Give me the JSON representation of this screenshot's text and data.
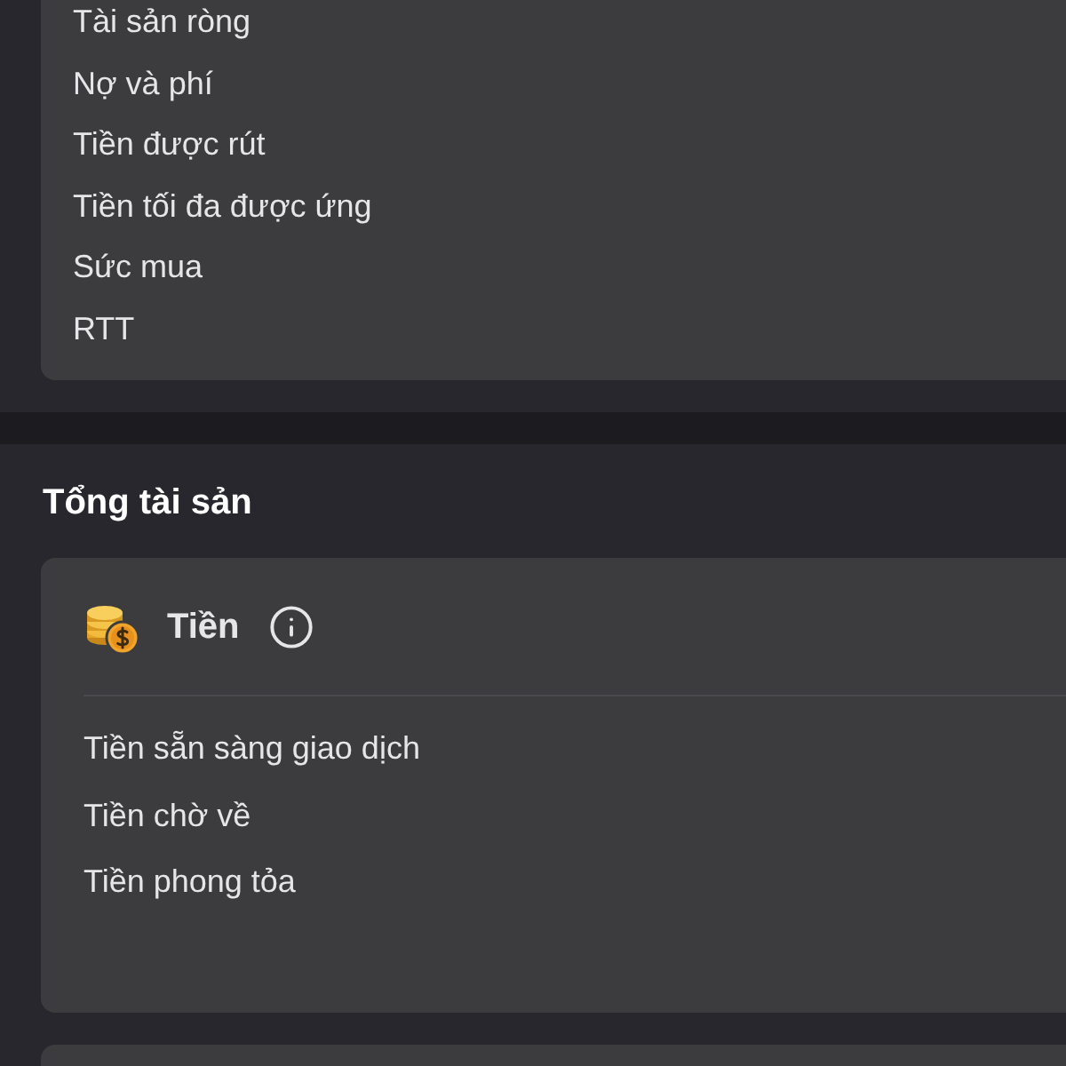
{
  "summary_card": {
    "items": [
      "Tài sản ròng",
      "Nợ và phí",
      "Tiền được rút",
      "Tiền tối đa được ứng",
      "Sức mua",
      "RTT"
    ]
  },
  "total_assets": {
    "title": "Tổng tài sản",
    "cash_card": {
      "title": "Tiền",
      "items": [
        "Tiền sẵn sàng giao dịch",
        "Tiền chờ về",
        "Tiền phong tỏa"
      ]
    }
  }
}
